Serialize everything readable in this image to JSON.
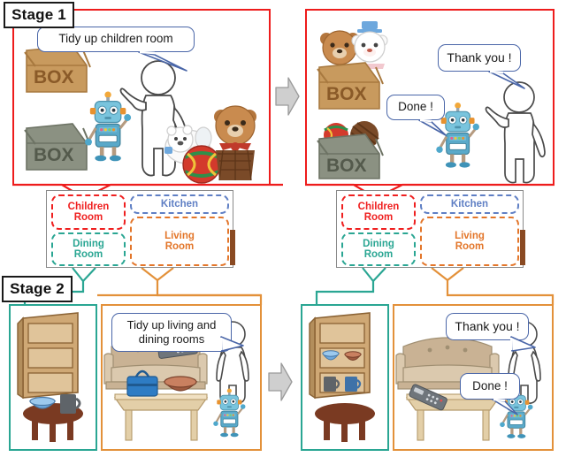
{
  "figure": {
    "type": "two-stage robot tidying scenario diagram",
    "colors": {
      "stage1_border": "#ee1c1c",
      "stage2_dining_border": "#2aa693",
      "stage2_living_border": "#e3913a",
      "bubble_border": "#4a66a8",
      "children_room": "#ef2020",
      "kitchen": "#5f7fc4",
      "dining_room": "#2aa693",
      "living_room": "#e3762a",
      "arrow_fill": "#cfcfcf",
      "arrow_stroke": "#9a9a9a"
    }
  },
  "stages": [
    {
      "id": "stage1",
      "label": "Stage 1"
    },
    {
      "id": "stage2",
      "label": "Stage 2"
    }
  ],
  "stage1": {
    "label": "Stage 1",
    "before": {
      "instruction_bubble": "Tidy up children room",
      "objects": [
        "box-brown",
        "box-gray",
        "robot",
        "person",
        "teddy-bear",
        "polar-bear-toy",
        "ball-toy",
        "basket-toy"
      ]
    },
    "after": {
      "robot_bubble": "Done !",
      "person_bubble": "Thank you !",
      "objects": [
        "box-brown-with-bears",
        "box-gray-with-balls",
        "robot",
        "person"
      ]
    }
  },
  "stage2": {
    "label": "Stage 2",
    "before": {
      "instruction_bubble": "Tidy up living and dining rooms",
      "dining_objects": [
        "shelf-empty",
        "table-round",
        "bowl-blue",
        "mug-gray"
      ],
      "living_objects": [
        "sofa",
        "remote-control-on-sofa",
        "low-table",
        "bag-blue",
        "bowl-brown",
        "person",
        "robot"
      ]
    },
    "after": {
      "robot_bubble": "Done !",
      "person_bubble": "Thank you !",
      "dining_objects": [
        "shelf-with-bowls-and-mugs",
        "table-round"
      ],
      "living_objects": [
        "sofa",
        "low-table",
        "remote-control-on-table",
        "person",
        "robot"
      ]
    }
  },
  "room_map": {
    "rooms": [
      {
        "id": "children",
        "label": "Children\nRoom",
        "line1": "Children",
        "line2": "Room",
        "color": "#ef2020"
      },
      {
        "id": "kitchen",
        "label": "Kitchen",
        "line1": "Kitchen",
        "line2": "",
        "color": "#5f7fc4"
      },
      {
        "id": "dining",
        "label": "Dining\nRoom",
        "line1": "Dining",
        "line2": "Room",
        "color": "#2aa693"
      },
      {
        "id": "living",
        "label": "Living\nRoom",
        "line1": "Living",
        "line2": "Room",
        "color": "#e3762a"
      }
    ]
  },
  "arrows": [
    {
      "id": "stage1-arrow",
      "direction": "right"
    },
    {
      "id": "stage2-arrow",
      "direction": "right"
    }
  ]
}
